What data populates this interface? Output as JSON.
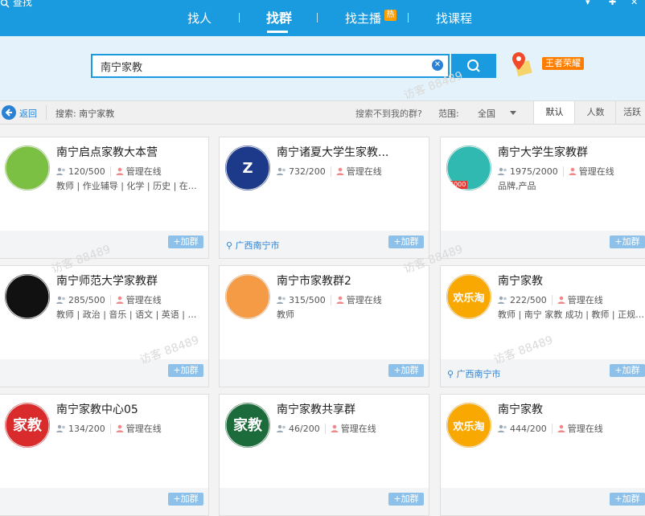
{
  "app": {
    "title": "查找"
  },
  "tabs": [
    {
      "label": "找人"
    },
    {
      "label": "找群",
      "active": true
    },
    {
      "label": "找主播",
      "badge": "热"
    },
    {
      "label": "找课程"
    }
  ],
  "search": {
    "value": "南宁家教",
    "placeholder": ""
  },
  "side_badge": "王者荣耀",
  "filter": {
    "back_label": "返回",
    "search_label": "搜索: 南宁家教",
    "not_found": "搜索不到我的群?",
    "range_label": "范围:",
    "range_value": "全国",
    "sort_tabs": [
      {
        "label": "默认",
        "active": true
      },
      {
        "label": "人数"
      },
      {
        "label": "活跃"
      }
    ]
  },
  "watermark": "访客 88489",
  "cards": [
    {
      "name": "南宁启点家教大本营",
      "members": "120/500",
      "status": "管理在线",
      "tags": "教师 | 作业辅导 | 化学 | 历史 | 在…",
      "location": "",
      "join": "+加群",
      "avatar_color": "#7cc043",
      "avatar_text": ""
    },
    {
      "name": "南宁诸夏大学生家教...",
      "members": "732/200",
      "status": "管理在线",
      "tags": "",
      "location": "广西南宁市",
      "join": "+加群",
      "avatar_color": "#1d3a8a",
      "avatar_text": "Z"
    },
    {
      "name": "南宁大学生家教群",
      "members": "1975/2000",
      "status": "管理在线",
      "tags": "品牌,产品",
      "location": "",
      "join": "+加群",
      "avatar_color": "#2fb9b0",
      "avatar_text": "",
      "avatar_badge": "2000"
    },
    {
      "name": "南宁师范大学家教群",
      "members": "285/500",
      "status": "管理在线",
      "tags": "教师 | 政治 | 音乐 | 语文 | 英语 | …",
      "location": "",
      "join": "+加群",
      "avatar_color": "#111111",
      "avatar_text": ""
    },
    {
      "name": "南宁市家教群2",
      "members": "315/500",
      "status": "管理在线",
      "tags": "教师",
      "location": "",
      "join": "+加群",
      "avatar_color": "#f59a45",
      "avatar_text": ""
    },
    {
      "name": "南宁家教",
      "members": "222/500",
      "status": "管理在线",
      "tags": "教师 | 南宁 家教 成功 | 教师 | 正规…",
      "location": "广西南宁市",
      "join": "+加群",
      "avatar_color": "#f8a800",
      "avatar_text": "欢乐淘"
    },
    {
      "name": "南宁家教中心05",
      "members": "134/200",
      "status": "管理在线",
      "tags": "",
      "location": "",
      "join": "+加群",
      "avatar_color": "#d92b2b",
      "avatar_text": "家教"
    },
    {
      "name": "南宁家教共享群",
      "members": "46/200",
      "status": "管理在线",
      "tags": "",
      "location": "",
      "join": "+加群",
      "avatar_color": "#1c6b3a",
      "avatar_text": "家教"
    },
    {
      "name": "南宁家教",
      "members": "444/200",
      "status": "管理在线",
      "tags": "",
      "location": "",
      "join": "+加群",
      "avatar_color": "#f8a800",
      "avatar_text": "欢乐淘"
    }
  ]
}
